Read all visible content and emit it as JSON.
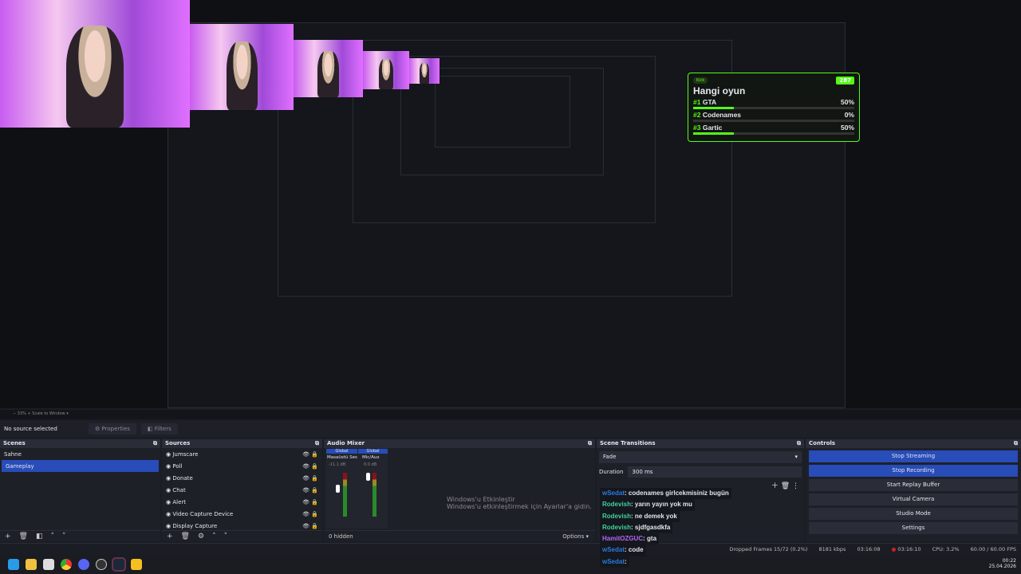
{
  "poll": {
    "badge": "Kick",
    "timer": "287",
    "title": "Hangi oyun",
    "options": [
      {
        "num": "#1",
        "label": "GTA",
        "pct": "50%",
        "value": 50
      },
      {
        "num": "#2",
        "label": "Codenames",
        "pct": "0%",
        "value": 0
      },
      {
        "num": "#3",
        "label": "Gartic",
        "pct": "50%",
        "value": 50
      }
    ],
    "accent": "#53fc18"
  },
  "zoom": {
    "level": "33%",
    "mode": "Scale to Window"
  },
  "propbar": {
    "status": "No source selected",
    "properties": "Properties",
    "filters": "Filters"
  },
  "scenes": {
    "title": "Scenes",
    "items": [
      "Sahne",
      "Gameplay"
    ],
    "selected": "Gameplay"
  },
  "sources": {
    "title": "Sources",
    "items": [
      "Jumscare",
      "Poll",
      "Donate",
      "Chat",
      "Alert",
      "Video Capture Device",
      "Display Capture"
    ]
  },
  "audio": {
    "title": "Audio Mixer",
    "channels": [
      {
        "tag": "Global",
        "name": "Masaüstü Ses",
        "db": "-11.1 dB",
        "level": 0.6
      },
      {
        "tag": "Global",
        "name": "Mic/Aux",
        "db": "0.0 dB",
        "level": 0.5
      }
    ],
    "hidden": "0 hidden",
    "options": "Options"
  },
  "transitions": {
    "title": "Scene Transitions",
    "type": "Fade",
    "duration_label": "Duration",
    "duration": "300 ms"
  },
  "controls": {
    "title": "Controls",
    "buttons": [
      "Stop Streaming",
      "Stop Recording",
      "Start Replay Buffer",
      "Virtual Camera",
      "Studio Mode",
      "Settings"
    ]
  },
  "status": {
    "dropped": "Dropped Frames 15/72 (0.2%)",
    "kbps": "8181 kbps",
    "stream_time": "03:16:08",
    "rec_time": "03:16:10",
    "cpu": "CPU: 3.2%",
    "fps": "60.00 / 60.00 FPS"
  },
  "chat": [
    {
      "user": "wSedat",
      "msg": ": codenames girlcekmisiniz bugün",
      "color": "#2a7be0"
    },
    {
      "user": "Rodevish",
      "msg": ": yarın yayın yok mu",
      "color": "#3fd39a"
    },
    {
      "user": "Rodevish",
      "msg": ": ne demek yok",
      "color": "#3fd39a"
    },
    {
      "user": "Rodevish",
      "msg": ": sjdfgasdkfa",
      "color": "#3fd39a"
    },
    {
      "user": "HamitOZGUC",
      "msg": ": gta",
      "color": "#b068f0"
    },
    {
      "user": "wSedat",
      "msg": ": code",
      "color": "#2a7be0"
    },
    {
      "user": "wSedat",
      "msg": ":",
      "color": "#2a7be0"
    }
  ],
  "watermark": {
    "line1": "Windows'u Etkinleştir",
    "line2": "Windows'u etkinleştirmek için Ayarlar'a gidin."
  },
  "clock": {
    "time": "00:22",
    "date": "25.04.2026"
  }
}
